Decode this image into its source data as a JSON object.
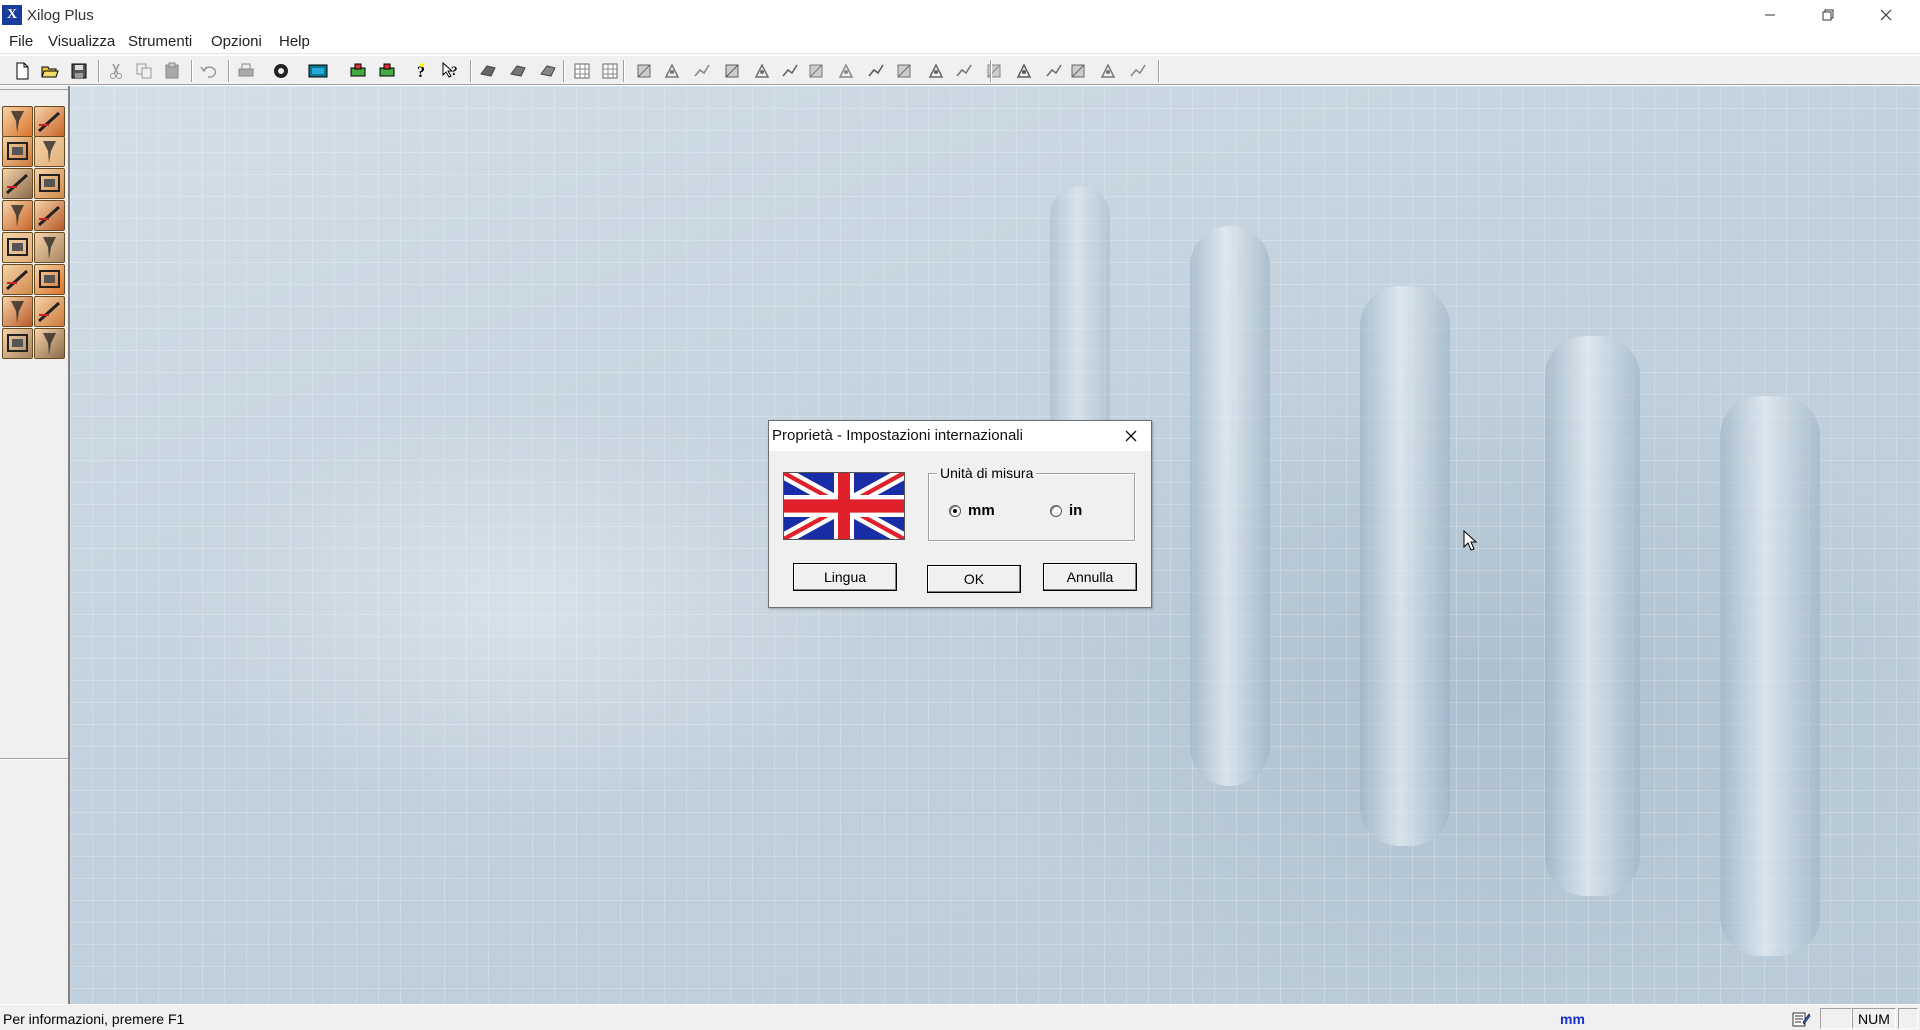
{
  "window": {
    "title": "Xilog Plus",
    "icon_letter": "X",
    "controls": [
      "minimize-icon",
      "restore-icon",
      "close-icon"
    ]
  },
  "menu": {
    "items": [
      "File",
      "Visualizza",
      "Strumenti",
      "Opzioni",
      "Help"
    ]
  },
  "toolbar": {
    "icons": [
      "new-file-icon",
      "open-folder-icon",
      "save-icon",
      "cut-icon",
      "copy-icon",
      "paste-icon",
      "undo-icon",
      "print-icon",
      "machine-settings-icon",
      "monitor-icon",
      "tool-a-icon",
      "tool-b-icon",
      "help-icon",
      "context-help-icon",
      "shape-1-icon",
      "shape-2-icon",
      "shape-3-icon",
      "grid-icon",
      "grid-2-icon",
      "op-1-icon",
      "op-2-icon",
      "op-3-icon",
      "op-4-icon",
      "op-5-icon",
      "op-6-icon",
      "op-7-icon",
      "op-8-icon",
      "op-9-icon",
      "op-10-icon",
      "op-11-icon",
      "op-12-icon",
      "op-13-icon",
      "op-14-icon",
      "op-15-icon",
      "op-16-icon",
      "op-17-icon",
      "op-18-icon"
    ]
  },
  "dialog": {
    "title": "Proprietà - Impostazioni internazionali",
    "flag": "united-kingdom-flag",
    "units_group_label": "Unità di misura",
    "unit_options": [
      {
        "label": "mm",
        "checked": true
      },
      {
        "label": "in",
        "checked": false
      }
    ],
    "buttons": {
      "language": "Lingua",
      "ok": "OK",
      "cancel": "Annulla"
    }
  },
  "statusbar": {
    "message": "Per informazioni, premere F1",
    "unit": "mm",
    "num": "NUM"
  },
  "colors": {
    "toolbar_bg": "#f0f0f0",
    "workspace_tint": "#c6d5e0",
    "status_unit": "#1a2fd0",
    "palette_orange": "#d9742a"
  }
}
